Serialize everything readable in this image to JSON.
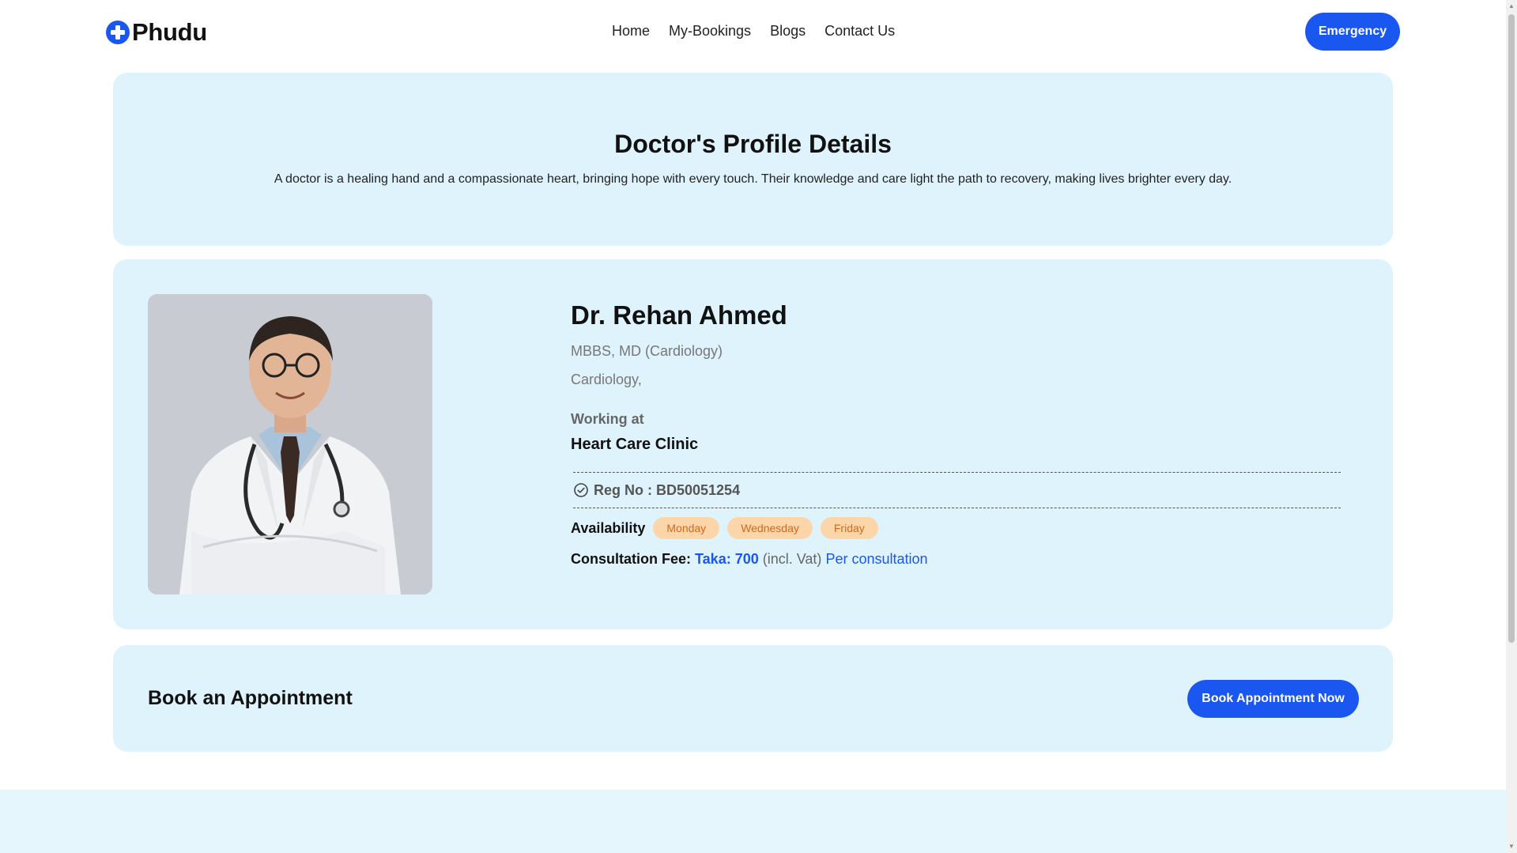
{
  "brand": {
    "name": "Phudu",
    "logo_icon": "plus-circle-icon",
    "accent_color": "#1a56f0"
  },
  "nav": {
    "items": [
      {
        "label": "Home"
      },
      {
        "label": "My-Bookings"
      },
      {
        "label": "Blogs"
      },
      {
        "label": "Contact Us"
      }
    ],
    "emergency_label": "Emergency"
  },
  "hero": {
    "title": "Doctor's Profile Details",
    "subtitle": "A doctor is a healing hand and a compassionate heart, bringing hope with every touch. Their knowledge and care light the path to recovery, making lives brighter every day."
  },
  "doctor": {
    "name": "Dr. Rehan Ahmed",
    "degree": "MBBS, MD (Cardiology)",
    "specialty": "Cardiology,",
    "working_at_label": "Working at",
    "clinic": "Heart Care Clinic",
    "reg_label": "Reg No : BD50051254",
    "availability_label": "Availability",
    "availability_days": [
      "Monday",
      "Wednesday",
      "Friday"
    ],
    "fee_label": "Consultation Fee:",
    "fee_amount": "Taka: 700",
    "fee_vat": "(incl. Vat)",
    "fee_per": "Per consultation"
  },
  "booking": {
    "title": "Book an Appointment",
    "button_label": "Book Appointment Now"
  }
}
